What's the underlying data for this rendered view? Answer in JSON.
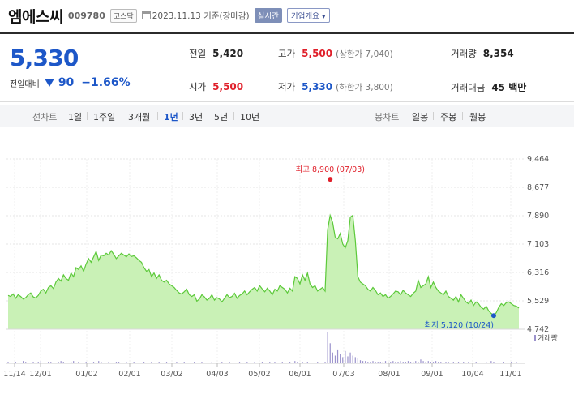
{
  "header": {
    "name": "엠에스씨",
    "code": "009780",
    "market": "코스닥",
    "date": "2023.11.13 기준(장마감)",
    "live_label": "실시간",
    "info_label": "기업개요 ▾"
  },
  "quote": {
    "price": "5,330",
    "change_label": "전일대비",
    "change": "90",
    "change_pct": "−1.66%"
  },
  "stats": {
    "prev_label": "전일",
    "prev": "5,420",
    "high_label": "고가",
    "high": "5,500",
    "upper_limit": "(상한가 7,040)",
    "volume_label": "거래량",
    "volume": "8,354",
    "open_label": "시가",
    "open": "5,500",
    "low_label": "저가",
    "low": "5,330",
    "lower_limit": "(하한가 3,800)",
    "amount_label": "거래대금",
    "amount": "45 백만"
  },
  "toolbar": {
    "line_chart_label": "선차트",
    "periods": [
      "1일",
      "1주일",
      "3개월",
      "1년",
      "3년",
      "5년",
      "10년"
    ],
    "selected_period": "1년",
    "candle_chart_label": "봉차트",
    "candle_periods": [
      "일봉",
      "주봉",
      "월봉"
    ]
  },
  "colors": {
    "up": "#e0202b",
    "down": "#1d57c8",
    "line": "#5cc93a",
    "fill": "#c9f1b6",
    "volume_bar": "#9b92cc"
  },
  "chart_data": {
    "type": "area",
    "x_ticks": [
      "11/14",
      "12/01",
      "01/02",
      "02/01",
      "03/02",
      "04/03",
      "05/02",
      "06/01",
      "07/03",
      "08/01",
      "09/01",
      "10/04",
      "11/01"
    ],
    "y_ticks": [
      "9,464",
      "8,677",
      "7,890",
      "7,103",
      "6,316",
      "5,529",
      "4,742"
    ],
    "ylim": [
      4742,
      9464
    ],
    "high_annotation": "최고 8,900 (07/03)",
    "high_value": 8900,
    "low_annotation": "최저 5,120 (10/24)",
    "low_value": 5120,
    "volume_label": "거래량",
    "series": [
      {
        "values": [
          5680,
          5650,
          5720,
          5600,
          5700,
          5650,
          5580,
          5620,
          5700,
          5750,
          5640,
          5610,
          5680,
          5800,
          5850,
          5750,
          5900,
          5950,
          5870,
          6050,
          6150,
          6080,
          6250,
          6150,
          6100,
          6300,
          6200,
          6450,
          6400,
          6500,
          6350,
          6550,
          6700,
          6600,
          6750,
          6900,
          6650,
          6800,
          6780,
          6850,
          6800,
          6920,
          6820,
          6700,
          6780,
          6850,
          6800,
          6750,
          6830,
          6760,
          6780,
          6720,
          6650,
          6600,
          6450,
          6350,
          6400,
          6200,
          6300,
          6150,
          6250,
          6100,
          6050,
          6100,
          6000,
          5950,
          5900,
          5820,
          5750,
          5720,
          5780,
          5850,
          5700,
          5650,
          5700,
          5520,
          5580,
          5700,
          5640,
          5550,
          5600,
          5700,
          5550,
          5620,
          5580,
          5500,
          5600,
          5700,
          5620,
          5650,
          5740,
          5600,
          5680,
          5720,
          5800,
          5700,
          5780,
          5850,
          5900,
          5800,
          5950,
          5860,
          5780,
          5880,
          5800,
          5700,
          5850,
          5800,
          5950,
          5900,
          5850,
          5750,
          5880,
          5800,
          6200,
          6150,
          6000,
          6250,
          6100,
          6300,
          6000,
          5900,
          5950,
          5800,
          5850,
          5900,
          5800,
          7500,
          7900,
          7700,
          7300,
          7250,
          7400,
          7100,
          7000,
          7200,
          7850,
          7900,
          7200,
          6200,
          6050,
          6000,
          5950,
          5850,
          5800,
          5900,
          5820,
          5700,
          5750,
          5650,
          5700,
          5600,
          5650,
          5720,
          5800,
          5780,
          5700,
          5820,
          5750,
          5700,
          5650,
          5740,
          5800,
          6100,
          5900,
          5950,
          6000,
          6200,
          5900,
          6050,
          5900,
          5800,
          5750,
          5700,
          5800,
          5650,
          5600,
          5550,
          5650,
          5500,
          5700,
          5600,
          5500,
          5450,
          5550,
          5400,
          5500,
          5450,
          5350,
          5300,
          5380,
          5250,
          5180,
          5120,
          5200,
          5350,
          5450,
          5400,
          5480,
          5500,
          5450,
          5400,
          5380,
          5330
        ]
      },
      {
        "name": "거래량",
        "values": [
          2,
          1,
          1,
          2,
          1,
          1,
          3,
          2,
          1,
          1,
          2,
          1,
          2,
          3,
          1,
          1,
          2,
          2,
          1,
          1,
          2,
          3,
          2,
          1,
          1,
          2,
          3,
          1,
          2,
          1,
          1,
          2,
          1,
          1,
          2,
          1,
          3,
          2,
          1,
          1,
          2,
          1,
          1,
          2,
          2,
          1,
          1,
          2,
          1,
          1,
          2,
          1,
          1,
          1,
          2,
          1,
          1,
          2,
          1,
          1,
          2,
          1,
          1,
          2,
          1,
          1,
          1,
          2,
          1,
          1,
          2,
          1,
          1,
          1,
          2,
          1,
          1,
          2,
          1,
          1,
          1,
          2,
          1,
          1,
          1,
          2,
          1,
          1,
          2,
          1,
          1,
          1,
          2,
          1,
          1,
          2,
          1,
          1,
          2,
          1,
          1,
          2,
          1,
          1,
          2,
          1,
          2,
          1,
          1,
          2,
          1,
          1,
          2,
          1,
          3,
          2,
          1,
          2,
          1,
          2,
          1,
          1,
          1,
          2,
          1,
          1,
          2,
          40,
          26,
          14,
          10,
          18,
          12,
          8,
          16,
          9,
          14,
          10,
          8,
          7,
          4,
          3,
          3,
          2,
          2,
          3,
          2,
          2,
          2,
          2,
          3,
          2,
          2,
          3,
          2,
          2,
          3,
          2,
          2,
          3,
          2,
          2,
          3,
          2,
          5,
          3,
          2,
          3,
          2,
          2,
          3,
          2,
          2,
          1,
          2,
          2,
          1,
          2,
          1,
          2,
          1,
          2,
          1,
          2,
          1,
          1,
          2,
          1,
          1,
          1,
          2,
          1,
          3,
          2,
          1,
          1,
          1,
          2,
          1,
          1,
          2,
          1,
          2,
          1
        ]
      }
    ]
  }
}
